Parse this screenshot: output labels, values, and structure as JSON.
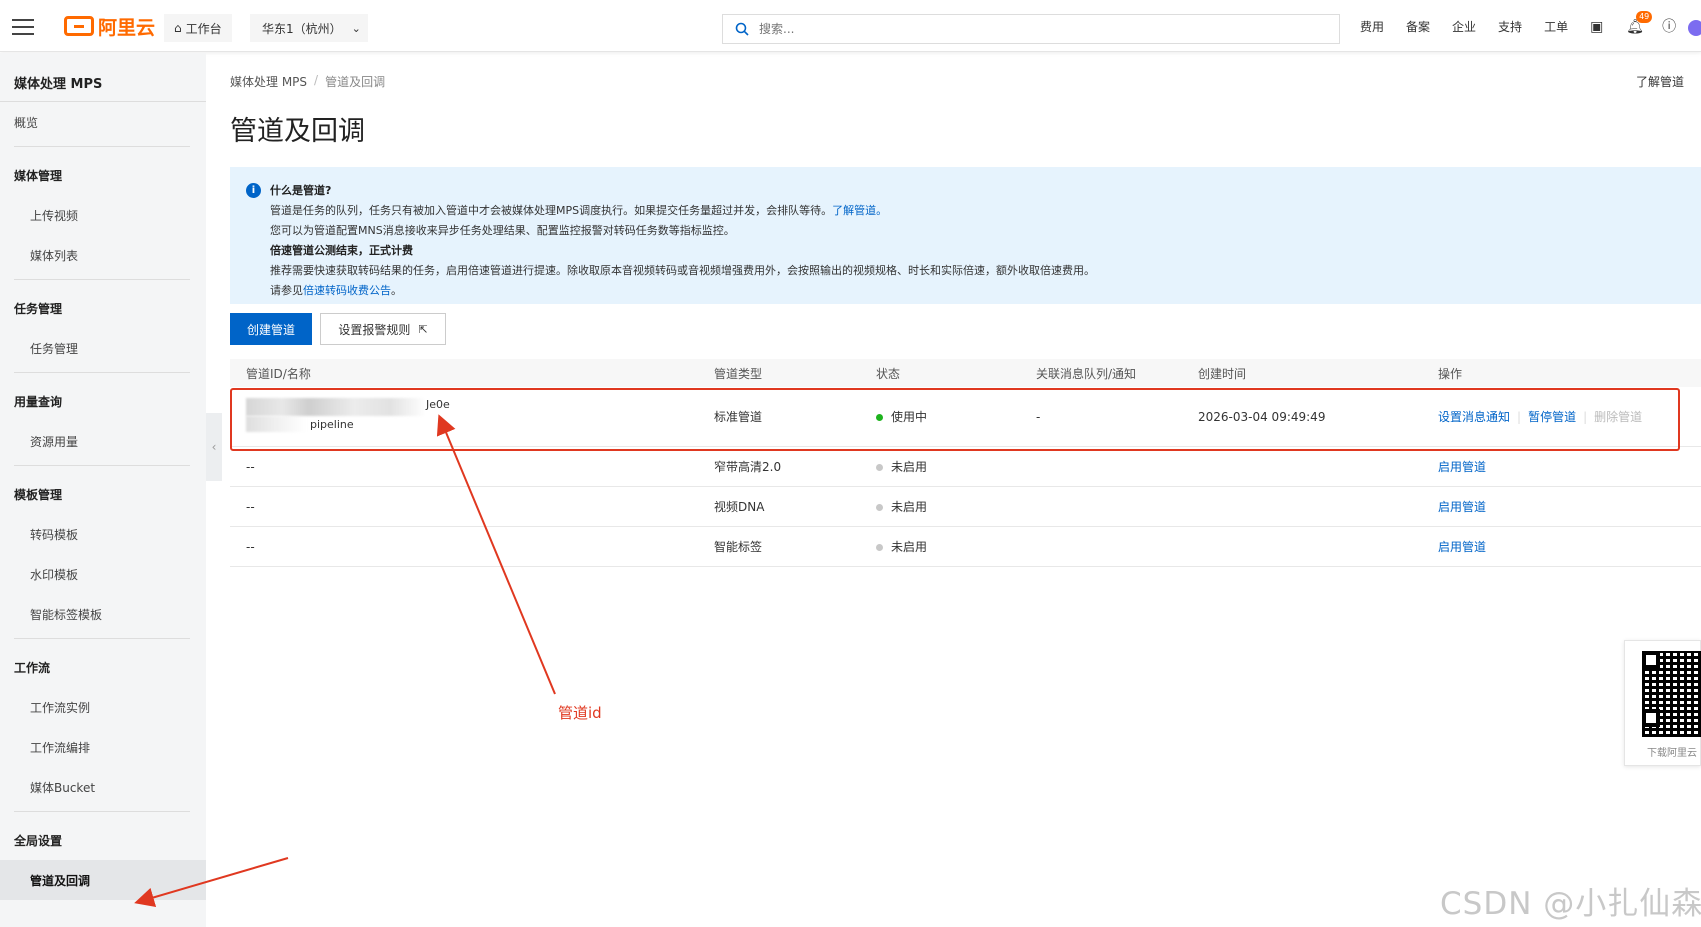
{
  "topbar": {
    "logo_text": "阿里云",
    "workbench_label": "工作台",
    "region_label": "华东1（杭州）",
    "search_placeholder": "搜索...",
    "nav": [
      "费用",
      "备案",
      "企业",
      "支持",
      "工单"
    ],
    "notification_count": "49"
  },
  "sidebar": {
    "title": "媒体处理 MPS",
    "overview": "概览",
    "groups": [
      {
        "title": "媒体管理",
        "items": [
          "上传视频",
          "媒体列表"
        ]
      },
      {
        "title": "任务管理",
        "items": [
          "任务管理"
        ]
      },
      {
        "title": "用量查询",
        "items": [
          "资源用量"
        ]
      },
      {
        "title": "模板管理",
        "items": [
          "转码模板",
          "水印模板",
          "智能标签模板"
        ]
      },
      {
        "title": "工作流",
        "items": [
          "工作流实例",
          "工作流编排",
          "媒体Bucket"
        ]
      },
      {
        "title": "全局设置",
        "items": [
          "管道及回调"
        ]
      }
    ]
  },
  "main": {
    "breadcrumb": [
      "媒体处理 MPS",
      "管道及回调"
    ],
    "learn_link": "了解管道",
    "title": "管道及回调",
    "info": {
      "heading1": "什么是管道?",
      "line1": "管道是任务的队列，任务只有被加入管道中才会被媒体处理MPS调度执行。如果提交任务量超过并发，会排队等待。",
      "line1_link": "了解管道。",
      "line2": "您可以为管道配置MNS消息接收来异步任务处理结果、配置监控报警对转码任务数等指标监控。",
      "heading2": "倍速管道公测结束，正式计费",
      "line3": "推荐需要快速获取转码结果的任务，启用倍速管道进行提速。除收取原本音视频转码或音视频增强费用外，会按照输出的视频规格、时长和实际倍速，额外收取倍速费用。",
      "line4_prefix": "请参见",
      "line4_link": "倍速转码收费公告",
      "line4_suffix": "。"
    },
    "create_button": "创建管道",
    "alarm_button": "设置报警规则",
    "table": {
      "headers": [
        "管道ID/名称",
        "管道类型",
        "状态",
        "关联消息队列/通知",
        "创建时间",
        "操作"
      ],
      "rows": [
        {
          "id_tail": "Je0e",
          "name": "pipeline",
          "type": "标准管道",
          "status": "使用中",
          "mq": "-",
          "created": "2026-03-04 09:49:49",
          "ops": [
            "设置消息通知",
            "暂停管道",
            "删除管道"
          ]
        },
        {
          "id": "--",
          "type": "窄带高清2.0",
          "status": "未启用",
          "ops": [
            "启用管道"
          ]
        },
        {
          "id": "--",
          "type": "视频DNA",
          "status": "未启用",
          "ops": [
            "启用管道"
          ]
        },
        {
          "id": "--",
          "type": "智能标签",
          "status": "未启用",
          "ops": [
            "启用管道"
          ]
        }
      ]
    }
  },
  "annotation_label": "管道id",
  "qr_label": "下载阿里云",
  "watermark": "CSDN @小扎仙森",
  "colors": {
    "accent": "#0064c8",
    "brand": "#ff6a00",
    "annotation": "#e03820",
    "active": "#1eb31e"
  }
}
